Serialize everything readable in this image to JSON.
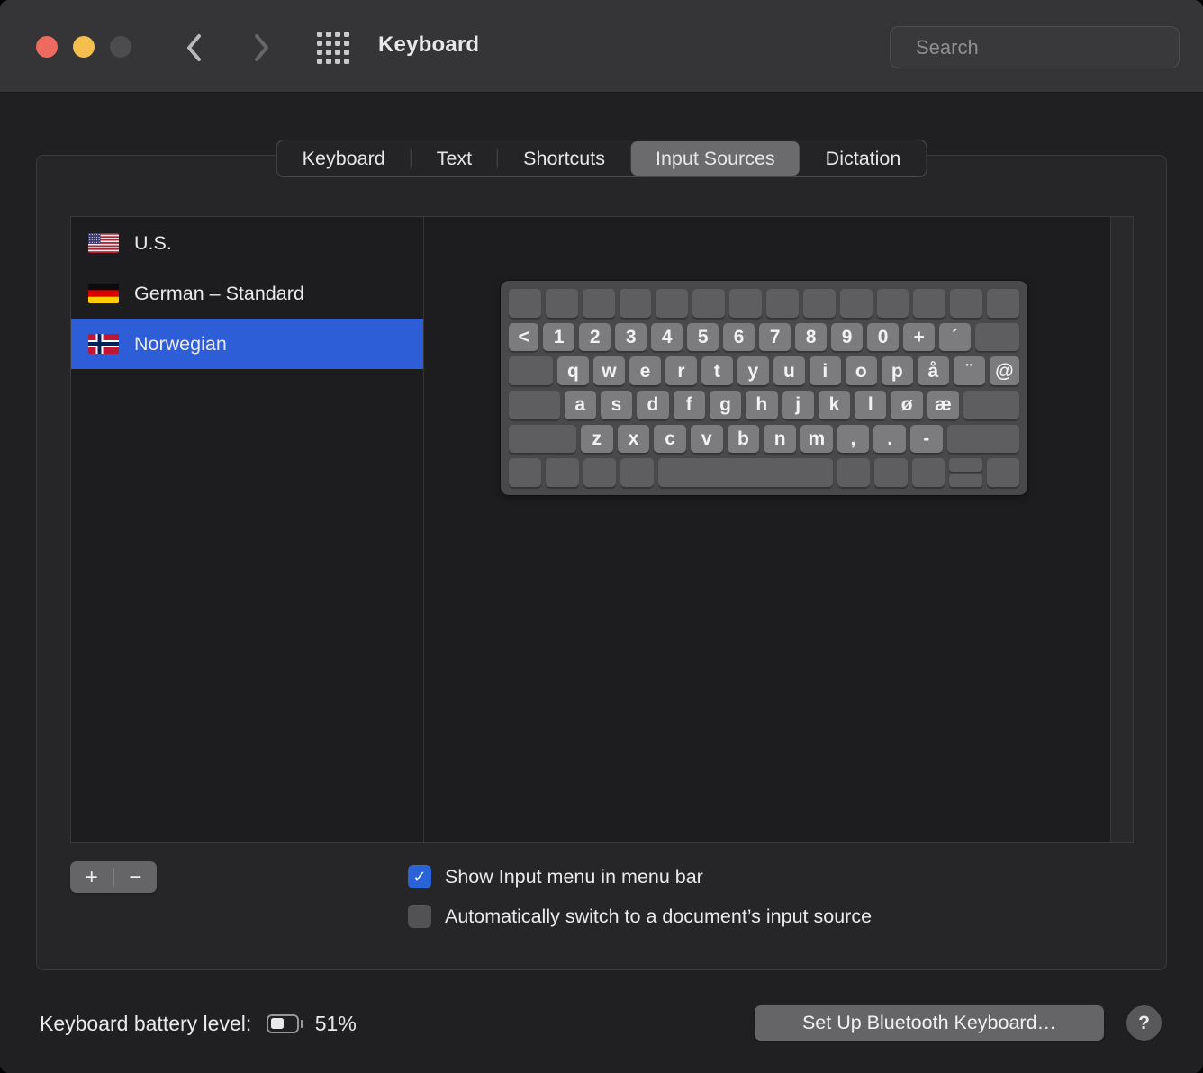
{
  "window": {
    "title": "Keyboard"
  },
  "titlebar": {
    "search": {
      "placeholder": "Search"
    }
  },
  "tabs": [
    {
      "label": "Keyboard",
      "selected": false
    },
    {
      "label": "Text",
      "selected": false
    },
    {
      "label": "Shortcuts",
      "selected": false
    },
    {
      "label": "Input Sources",
      "selected": true
    },
    {
      "label": "Dictation",
      "selected": false
    }
  ],
  "input_sources": {
    "items": [
      {
        "label": "U.S.",
        "flag": "us",
        "selected": false
      },
      {
        "label": "German – Standard",
        "flag": "de",
        "selected": false
      },
      {
        "label": "Norwegian",
        "flag": "no",
        "selected": true
      }
    ],
    "add_label": "+",
    "remove_label": "−"
  },
  "keyboard_preview": {
    "rows": [
      {
        "keys": [
          {},
          {},
          {},
          {},
          {},
          {},
          {},
          {},
          {},
          {},
          {},
          {},
          {},
          {}
        ]
      },
      {
        "keys": [
          {
            "l": "<",
            "w": 0.95
          },
          {
            "l": "1"
          },
          {
            "l": "2"
          },
          {
            "l": "3"
          },
          {
            "l": "4"
          },
          {
            "l": "5"
          },
          {
            "l": "6"
          },
          {
            "l": "7"
          },
          {
            "l": "8"
          },
          {
            "l": "9"
          },
          {
            "l": "0"
          },
          {
            "l": "+"
          },
          {
            "l": "´"
          },
          {
            "w": 1.4
          }
        ]
      },
      {
        "keys": [
          {
            "w": 1.4
          },
          {
            "l": "q"
          },
          {
            "l": "w"
          },
          {
            "l": "e"
          },
          {
            "l": "r"
          },
          {
            "l": "t"
          },
          {
            "l": "y"
          },
          {
            "l": "u"
          },
          {
            "l": "i"
          },
          {
            "l": "o"
          },
          {
            "l": "p"
          },
          {
            "l": "å"
          },
          {
            "l": "¨"
          },
          {
            "l": "@",
            "w": 0.95
          }
        ]
      },
      {
        "keys": [
          {
            "w": 1.6
          },
          {
            "l": "a"
          },
          {
            "l": "s"
          },
          {
            "l": "d"
          },
          {
            "l": "f"
          },
          {
            "l": "g"
          },
          {
            "l": "h"
          },
          {
            "l": "j"
          },
          {
            "l": "k"
          },
          {
            "l": "l"
          },
          {
            "l": "ø"
          },
          {
            "l": "æ"
          },
          {
            "w": 1.75
          }
        ]
      },
      {
        "keys": [
          {
            "w": 2.1
          },
          {
            "l": "z"
          },
          {
            "l": "x"
          },
          {
            "l": "c"
          },
          {
            "l": "v"
          },
          {
            "l": "b"
          },
          {
            "l": "n"
          },
          {
            "l": "m"
          },
          {
            "l": ","
          },
          {
            "l": "."
          },
          {
            "l": "-"
          },
          {
            "w": 2.25
          }
        ]
      },
      {
        "keys": [
          {},
          {},
          {},
          {},
          {
            "w": 5.35
          },
          {},
          {},
          {},
          {
            "split": true
          },
          {}
        ]
      }
    ]
  },
  "options": [
    {
      "label": "Show Input menu in menu bar",
      "checked": true
    },
    {
      "label": "Automatically switch to a document’s input source",
      "checked": false
    }
  ],
  "footer": {
    "battery_label": "Keyboard battery level:",
    "battery_percent": "51%",
    "battery_fraction": 0.51,
    "setup_button": "Set Up Bluetooth Keyboard…",
    "help_button": "?"
  },
  "colors": {
    "selection_blue": "#2d5dd7",
    "checkbox_blue": "#2a63d8",
    "traffic_red": "#ec6a5e",
    "traffic_yellow": "#f4bf4f",
    "traffic_gray": "#4c4c4e"
  }
}
